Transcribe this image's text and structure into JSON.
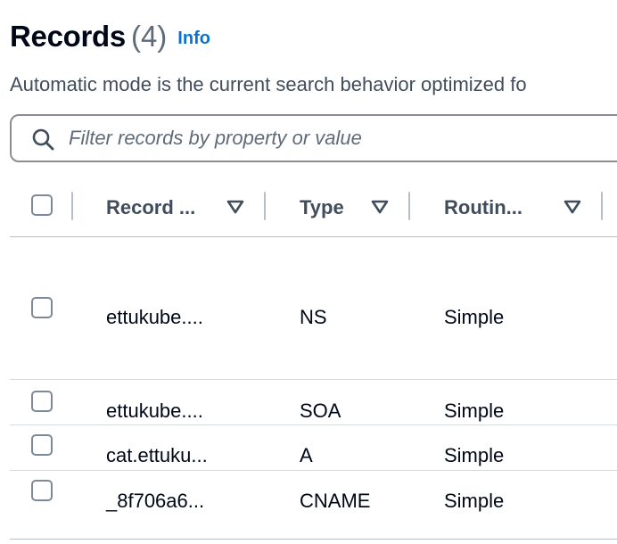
{
  "header": {
    "title": "Records",
    "count": "(4)",
    "info": "Info"
  },
  "description": "Automatic mode is the current search behavior optimized fo",
  "search": {
    "placeholder": "Filter records by property or value"
  },
  "icons": {
    "search": "search-icon",
    "sort": "sort-down-icon",
    "checkbox": "checkbox-icon"
  },
  "colors": {
    "link": "#0972d3",
    "text": "#000716",
    "muted": "#5f6b7a",
    "border": "#8c8c94"
  },
  "table": {
    "columns": [
      {
        "label": "Record ..."
      },
      {
        "label": "Type"
      },
      {
        "label": "Routin..."
      }
    ],
    "rows": [
      {
        "name": "ettukube....",
        "type": "NS",
        "routing": "Simple"
      },
      {
        "name": "ettukube....",
        "type": "SOA",
        "routing": "Simple"
      },
      {
        "name": "cat.ettuku...",
        "type": "A",
        "routing": "Simple"
      },
      {
        "name": "_8f706a6...",
        "type": "CNAME",
        "routing": "Simple"
      }
    ]
  }
}
